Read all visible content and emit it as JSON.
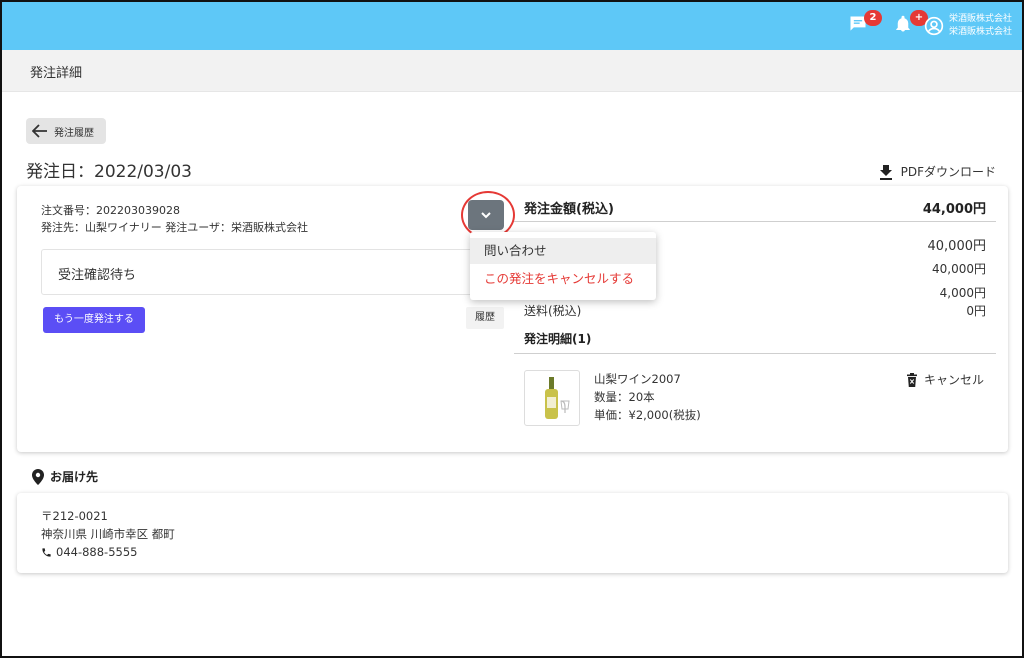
{
  "header": {
    "messages_badge": "2",
    "notifications_badge": "+",
    "company_line1": "栄酒販株式会社",
    "company_line2": "栄酒販株式会社",
    "colors": {
      "topbar": "#5ec8f7",
      "badge": "#e53935"
    }
  },
  "subheader": {
    "title": "発注詳細"
  },
  "back_button": {
    "label": "発注履歴"
  },
  "order": {
    "date_label": "発注日：2022/03/03",
    "pdf_label": "PDFダウンロード",
    "number_line": "注文番号：202203039028",
    "supplier_line": "発注先：山梨ワイナリー 発注ユーザ：栄酒販株式会社",
    "status": "受注確認待ち",
    "reorder_label": "もう一度発注する",
    "history_label": "履歴"
  },
  "dropdown_menu": {
    "items": [
      "問い合わせ",
      "この発注をキャンセルする"
    ]
  },
  "amount": {
    "title": "発注金額(税込)",
    "total": "44,000円",
    "values": [
      "40,000円",
      "40,000円",
      "4,000円"
    ],
    "shipping_label": "送料(税込)",
    "shipping_value": "0円"
  },
  "details": {
    "title": "発注明細(1)",
    "product_name": "山梨ワイン2007",
    "quantity": "数量：20本",
    "unit_price": "単価：¥2,000(税抜)",
    "cancel_label": "キャンセル"
  },
  "delivery": {
    "title": "お届け先",
    "postal": "〒212-0021",
    "address": "神奈川県 川崎市幸区 都町",
    "phone": "044-888-5555"
  }
}
